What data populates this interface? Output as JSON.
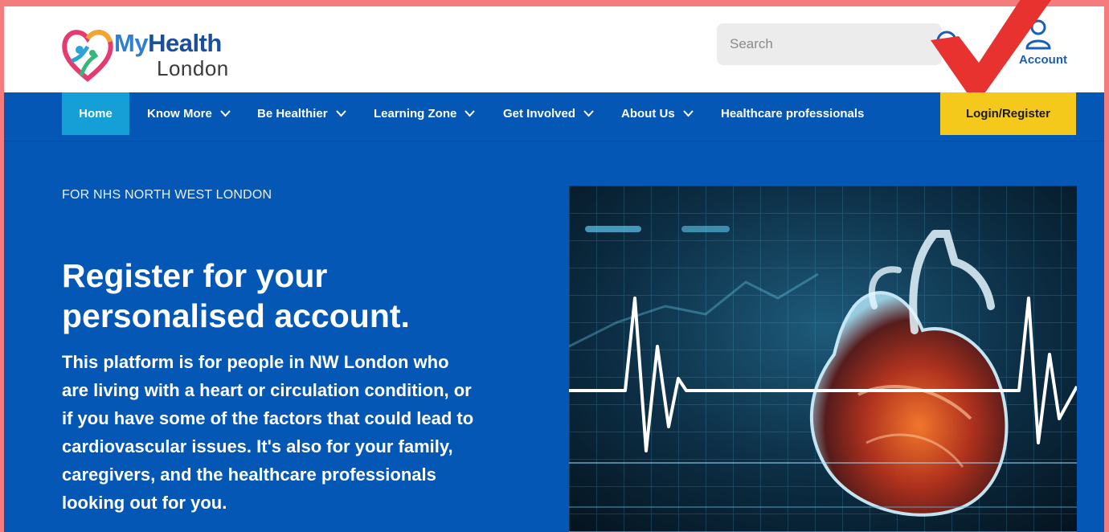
{
  "header": {
    "logo": {
      "my": "My",
      "health": "Health",
      "london": "London"
    },
    "search": {
      "placeholder": "Search"
    },
    "account_label": "Account"
  },
  "nav": {
    "items": [
      {
        "label": "Home"
      },
      {
        "label": "Know More"
      },
      {
        "label": "Be Healthier"
      },
      {
        "label": "Learning Zone"
      },
      {
        "label": "Get Involved"
      },
      {
        "label": "About Us"
      },
      {
        "label": "Healthcare professionals"
      }
    ],
    "login_label": "Login/Register"
  },
  "hero": {
    "eyebrow": "FOR NHS NORTH WEST LONDON",
    "title": "Register for your personalised account.",
    "body": "This platform is for people in NW London who are living with a heart or circulation condition, or if you have some of the factors that could lead to cardiovascular issues.  It's also for your family, caregivers, and the healthcare professionals looking out for you.",
    "image": "heart-ecg-image"
  },
  "colors": {
    "brand_blue": "#0457b5",
    "home_tab": "#14a0d6",
    "login_button": "#f5c91c",
    "annotation_arrow": "#e8322f",
    "page_border": "#f47c7c"
  }
}
